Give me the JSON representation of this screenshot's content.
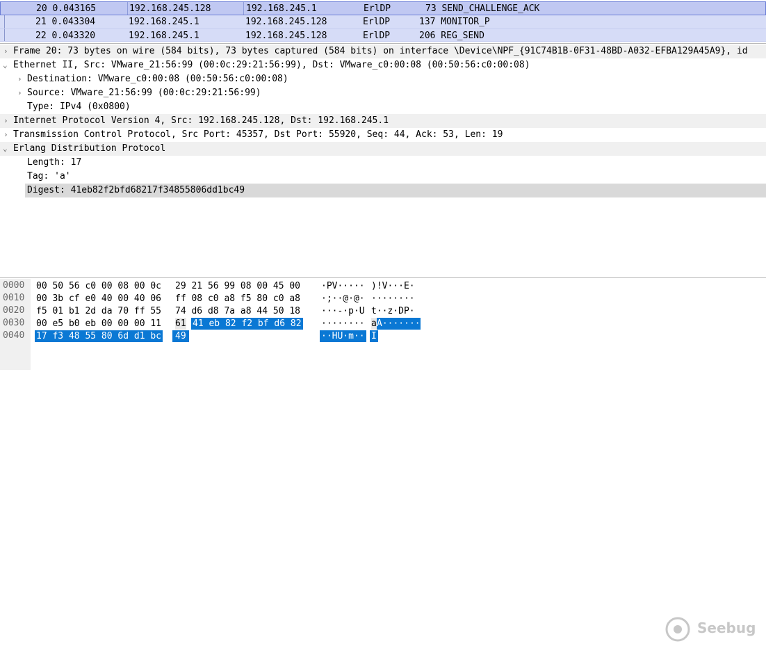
{
  "packet_list": {
    "rows": [
      {
        "no_time": "20 0.043165",
        "source": "192.168.245.128",
        "destination": "192.168.245.1",
        "protocol": "ErlDP",
        "length_info": "73 SEND_CHALLENGE_ACK"
      },
      {
        "no_time": "21 0.043304",
        "source": "192.168.245.1",
        "destination": "192.168.245.128",
        "protocol": "ErlDP",
        "length_info": "137 MONITOR_P"
      },
      {
        "no_time": "22 0.043320",
        "source": "192.168.245.1",
        "destination": "192.168.245.128",
        "protocol": "ErlDP",
        "length_info": "206 REG_SEND"
      }
    ]
  },
  "details": {
    "frame": "Frame 20: 73 bytes on wire (584 bits), 73 bytes captured (584 bits) on interface \\Device\\NPF_{91C74B1B-0F31-48BD-A032-EFBA129A45A9}, id",
    "ethernet": "Ethernet II, Src: VMware_21:56:99 (00:0c:29:21:56:99), Dst: VMware_c0:00:08 (00:50:56:c0:00:08)",
    "eth_destination": "Destination: VMware_c0:00:08 (00:50:56:c0:00:08)",
    "eth_source": "Source: VMware_21:56:99 (00:0c:29:21:56:99)",
    "eth_type": "Type: IPv4 (0x0800)",
    "ip": "Internet Protocol Version 4, Src: 192.168.245.128, Dst: 192.168.245.1",
    "tcp": "Transmission Control Protocol, Src Port: 45357, Dst Port: 55920, Seq: 44, Ack: 53, Len: 19",
    "erldp": "Erlang Distribution Protocol",
    "erl_length": "Length: 17",
    "erl_tag": "Tag: 'a'",
    "erl_digest": "Digest: 41eb82f2bfd68217f34855806dd1bc49"
  },
  "bytes": {
    "offsets": [
      "0000",
      "0010",
      "0020",
      "0030",
      "0040"
    ],
    "r0": {
      "h1": "00 50 56 c0 00 08 00 0c",
      "h2": "29 21 56 99 08 00 45 00",
      "a1": "·PV·····",
      "a2": ")!V···E·"
    },
    "r1": {
      "h1": "00 3b cf e0 40 00 40 06",
      "h2": "ff 08 c0 a8 f5 80 c0 a8",
      "a1": "·;··@·@·",
      "a2": "········"
    },
    "r2": {
      "h1": "f5 01 b1 2d da 70 ff 55",
      "h2": "74 d6 d8 7a a8 44 50 18",
      "a1": "···-·p·U",
      "a2": "t··z·DP·"
    },
    "r3": {
      "h1": "00 e5 b0 eb 00 00 00 11",
      "h2a": "61",
      "h2b": "41 eb 82 f2 bf d6 82",
      "a1": "········",
      "a2a": "a",
      "a2b": "A·······"
    },
    "r4": {
      "h1": "17 f3 48 55 80 6d d1 bc",
      "h2": "49",
      "a1": "··HU·m··",
      "a2": "I"
    }
  },
  "watermark": {
    "text": "Seebug"
  },
  "colors": {
    "selected_bytes": "#0a78d4",
    "packet_row": "#d6dcf7",
    "header_row": "#f0f0f0",
    "highlight_field": "#d9d9d9"
  }
}
